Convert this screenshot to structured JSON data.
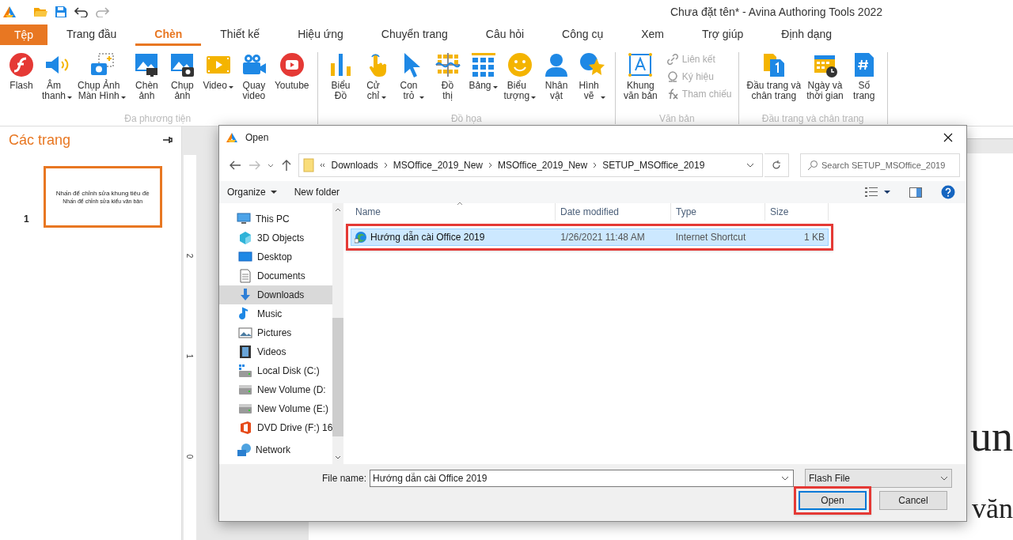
{
  "window": {
    "title": "Chưa đặt tên* - Avina Authoring Tools 2022"
  },
  "menu_tabs": [
    {
      "label": "Tệp",
      "kind": "file",
      "selected": false
    },
    {
      "label": "Trang đầu",
      "kind": "tab",
      "selected": false
    },
    {
      "label": "Chèn",
      "kind": "tab",
      "selected": true
    },
    {
      "label": "Thiết kế",
      "kind": "tab",
      "selected": false
    },
    {
      "label": "Hiệu ứng",
      "kind": "tab",
      "selected": false
    },
    {
      "label": "Chuyển trang",
      "kind": "tab",
      "selected": false
    },
    {
      "label": "Câu hỏi",
      "kind": "tab",
      "selected": false
    },
    {
      "label": "Công cụ",
      "kind": "tab",
      "selected": false
    },
    {
      "label": "Xem",
      "kind": "tab",
      "selected": false
    },
    {
      "label": "Trợ giúp",
      "kind": "tab",
      "selected": false
    },
    {
      "label": "Định dạng",
      "kind": "tab",
      "selected": false
    }
  ],
  "ribbon_groups": [
    {
      "label": "Đa phương tiện",
      "items": [
        {
          "label": "Flash",
          "kind": "flash",
          "dropdown": false
        },
        {
          "label": "Âm\nthanh",
          "kind": "sound",
          "dropdown": true
        },
        {
          "label": "Chụp Ảnh\nMàn Hình",
          "kind": "screenshot",
          "dropdown": true
        },
        {
          "label": "Chèn\nảnh",
          "kind": "image",
          "dropdown": false
        },
        {
          "label": "Chụp\nảnh",
          "kind": "photo",
          "dropdown": false
        },
        {
          "label": "Video",
          "kind": "video",
          "dropdown": true
        },
        {
          "label": "Quay\nvideo",
          "kind": "record",
          "dropdown": false
        },
        {
          "label": "Youtube",
          "kind": "youtube",
          "dropdown": false
        }
      ]
    },
    {
      "label": "Đồ họa",
      "items": [
        {
          "label": "Biểu\nĐồ",
          "kind": "chart",
          "dropdown": false
        },
        {
          "label": "Cử\nchỉ",
          "kind": "gesture",
          "dropdown": true
        },
        {
          "label": "Con\ntrỏ",
          "kind": "cursor",
          "dropdown": true
        },
        {
          "label": "Đồ\nthị",
          "kind": "graph",
          "dropdown": false
        },
        {
          "label": "Bảng",
          "kind": "table",
          "dropdown": true
        },
        {
          "label": "Biểu\ntượng",
          "kind": "emoji",
          "dropdown": true
        },
        {
          "label": "Nhân\nvật",
          "kind": "person",
          "dropdown": false
        },
        {
          "label": "Hình\nvẽ",
          "kind": "shapes",
          "dropdown": true
        }
      ]
    },
    {
      "label": "Văn bản",
      "items": [
        {
          "label": "Khung\nvăn bản",
          "kind": "textbox",
          "dropdown": false
        }
      ],
      "small_items": [
        {
          "label": "Liên kết",
          "kind": "link",
          "disabled": true
        },
        {
          "label": "Ký hiệu",
          "kind": "symbol",
          "disabled": true
        },
        {
          "label": "Tham chiếu",
          "kind": "function",
          "disabled": true
        }
      ]
    },
    {
      "label": "Đầu trang và chân trang",
      "items": [
        {
          "label": "Đầu trang và\nchân trang",
          "kind": "header",
          "dropdown": false
        },
        {
          "label": "Ngày và\nthời gian",
          "kind": "date",
          "dropdown": false
        },
        {
          "label": "Số\ntrang",
          "kind": "pagenum",
          "dropdown": false
        }
      ]
    }
  ],
  "pages_panel": {
    "title": "Các trang",
    "slides": [
      {
        "number": "1",
        "title": "Nhấn để chỉnh sửa khung tiêu đề",
        "subtitle": "Nhấn để chỉnh sửa kiểu văn bản",
        "selected": true
      }
    ]
  },
  "ruler_labels": [
    "2",
    "1",
    "0"
  ],
  "canvas": {
    "title_fragment": "un",
    "subtitle_fragment": "văn"
  },
  "dialog": {
    "title": "Open",
    "breadcrumb": [
      "Downloads",
      "MSOffice_2019_New",
      "MSOffice_2019_New",
      "SETUP_MSOffice_2019"
    ],
    "search": {
      "placeholder": "Search SETUP_MSOffice_2019"
    },
    "toolbar": [
      {
        "label": "Organize",
        "dropdown": true
      },
      {
        "label": "New folder",
        "dropdown": false
      }
    ],
    "nav": [
      {
        "label": "This PC",
        "kind": "pc",
        "selected": false,
        "children": [
          {
            "label": "3D Objects",
            "kind": "cube",
            "selected": false
          },
          {
            "label": "Desktop",
            "kind": "desktop",
            "selected": false
          },
          {
            "label": "Documents",
            "kind": "documents",
            "selected": false
          },
          {
            "label": "Downloads",
            "kind": "downloads",
            "selected": true
          },
          {
            "label": "Music",
            "kind": "music",
            "selected": false
          },
          {
            "label": "Pictures",
            "kind": "pictures",
            "selected": false
          },
          {
            "label": "Videos",
            "kind": "videos",
            "selected": false
          },
          {
            "label": "Local Disk (C:)",
            "kind": "system_disk",
            "selected": false
          },
          {
            "label": "New Volume (D:",
            "kind": "disk",
            "selected": false
          },
          {
            "label": "New Volume (E:)",
            "kind": "disk",
            "selected": false
          },
          {
            "label": "DVD Drive (F:) 16",
            "kind": "dvd",
            "selected": false
          }
        ]
      },
      {
        "label": "Network",
        "kind": "network",
        "selected": false
      }
    ],
    "columns": [
      "Name",
      "Date modified",
      "Type",
      "Size"
    ],
    "rows": [
      {
        "name": "Hướng dẫn cài Office 2019",
        "date": "1/26/2021 11:48 AM",
        "type": "Internet Shortcut",
        "size": "1 KB",
        "selected": true,
        "highlighted": true
      }
    ],
    "file_name": {
      "label": "File name:",
      "value": "Hướng dẫn cài Office 2019"
    },
    "file_type": "Flash File",
    "buttons": [
      {
        "label": "Open",
        "default": true,
        "highlighted": true
      },
      {
        "label": "Cancel",
        "default": false,
        "highlighted": false
      }
    ]
  }
}
